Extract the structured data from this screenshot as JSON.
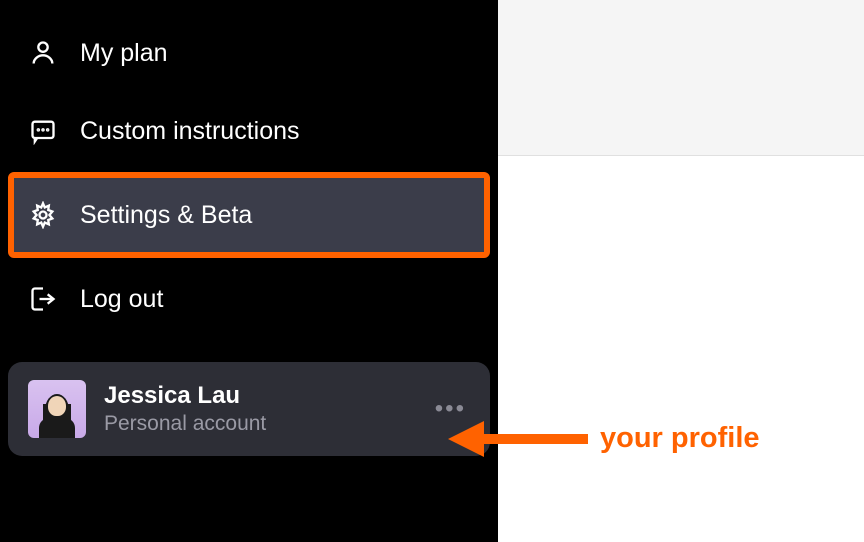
{
  "menu": {
    "items": [
      {
        "label": "My plan",
        "icon": "user"
      },
      {
        "label": "Custom instructions",
        "icon": "chat"
      },
      {
        "label": "Settings & Beta",
        "icon": "gear",
        "highlighted": true
      },
      {
        "label": "Log out",
        "icon": "logout"
      }
    ]
  },
  "profile": {
    "name": "Jessica Lau",
    "type": "Personal account"
  },
  "annotation": {
    "label": "your profile"
  },
  "colors": {
    "highlight": "#ff6200",
    "sidebar_bg": "#000000",
    "card_bg": "#2d2e36"
  }
}
